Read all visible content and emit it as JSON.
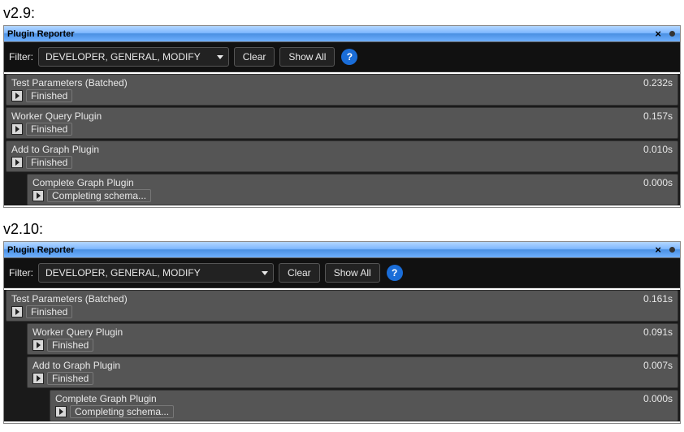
{
  "versions": [
    {
      "label": "v2.9:",
      "panel_title": "Plugin Reporter",
      "filter_label": "Filter:",
      "filter_value": "DEVELOPER, GENERAL, MODIFY",
      "clear_label": "Clear",
      "showall_label": "Show All",
      "rows": [
        {
          "name": "Test Parameters (Batched)",
          "time": "0.232s",
          "status": "Finished",
          "indent": 0
        },
        {
          "name": "Worker Query Plugin",
          "time": "0.157s",
          "status": "Finished",
          "indent": 0
        },
        {
          "name": "Add to Graph Plugin",
          "time": "0.010s",
          "status": "Finished",
          "indent": 0
        },
        {
          "name": "Complete Graph Plugin",
          "time": "0.000s",
          "status": "Completing schema...",
          "indent": 1
        }
      ]
    },
    {
      "label": "v2.10:",
      "panel_title": "Plugin Reporter",
      "filter_label": "Filter:",
      "filter_value": "DEVELOPER, GENERAL, MODIFY",
      "clear_label": "Clear",
      "showall_label": "Show All",
      "rows": [
        {
          "name": "Test Parameters (Batched)",
          "time": "0.161s",
          "status": "Finished",
          "indent": 0
        },
        {
          "name": "Worker Query Plugin",
          "time": "0.091s",
          "status": "Finished",
          "indent": 1
        },
        {
          "name": "Add to Graph Plugin",
          "time": "0.007s",
          "status": "Finished",
          "indent": 1
        },
        {
          "name": "Complete Graph Plugin",
          "time": "0.000s",
          "status": "Completing schema...",
          "indent": 2
        }
      ]
    }
  ]
}
